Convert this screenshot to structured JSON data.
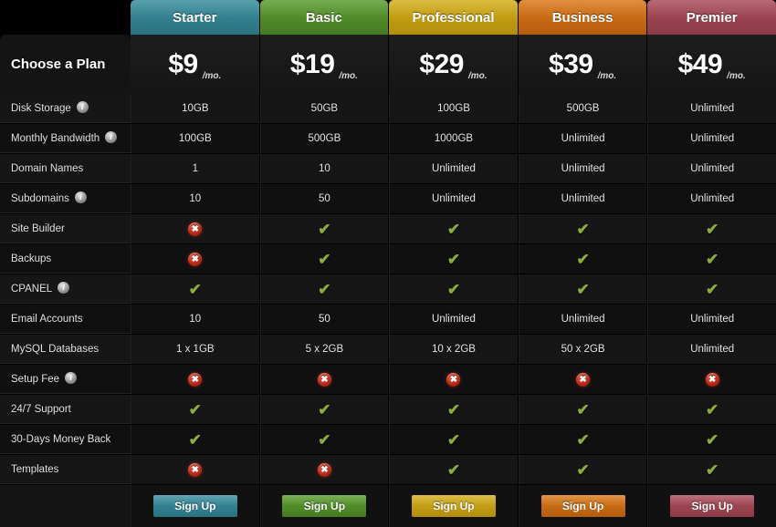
{
  "left_panel": {
    "title": "Choose a Plan"
  },
  "plans": [
    {
      "name": "Starter",
      "price": "$9",
      "per": "/mo.",
      "color": "#3a8f9e",
      "color_dark": "#2b7280",
      "signup_label": "Sign Up"
    },
    {
      "name": "Basic",
      "price": "$19",
      "per": "/mo.",
      "color": "#5c9d2f",
      "color_dark": "#467a22",
      "signup_label": "Sign Up"
    },
    {
      "name": "Professional",
      "price": "$29",
      "per": "/mo.",
      "color": "#d4ae1c",
      "color_dark": "#b08d0c",
      "signup_label": "Sign Up"
    },
    {
      "name": "Business",
      "price": "$39",
      "per": "/mo.",
      "color": "#da7a1c",
      "color_dark": "#b35c0d",
      "signup_label": "Sign Up"
    },
    {
      "name": "Premier",
      "price": "$49",
      "per": "/mo.",
      "color": "#ab4d5b",
      "color_dark": "#8c3a47",
      "signup_label": "Sign Up"
    }
  ],
  "features": [
    {
      "label": "Disk Storage",
      "info": true,
      "values": [
        "10GB",
        "50GB",
        "100GB",
        "500GB",
        "Unlimited"
      ]
    },
    {
      "label": "Monthly Bandwidth",
      "info": true,
      "values": [
        "100GB",
        "500GB",
        "1000GB",
        "Unlimited",
        "Unlimited"
      ]
    },
    {
      "label": "Domain Names",
      "info": false,
      "values": [
        "1",
        "10",
        "Unlimited",
        "Unlimited",
        "Unlimited"
      ]
    },
    {
      "label": "Subdomains",
      "info": true,
      "values": [
        "10",
        "50",
        "Unlimited",
        "Unlimited",
        "Unlimited"
      ]
    },
    {
      "label": "Site Builder",
      "info": false,
      "values": [
        "no",
        "yes",
        "yes",
        "yes",
        "yes"
      ]
    },
    {
      "label": "Backups",
      "info": false,
      "values": [
        "no",
        "yes",
        "yes",
        "yes",
        "yes"
      ]
    },
    {
      "label": "CPANEL",
      "info": true,
      "values": [
        "yes",
        "yes",
        "yes",
        "yes",
        "yes"
      ]
    },
    {
      "label": "Email Accounts",
      "info": false,
      "values": [
        "10",
        "50",
        "Unlimited",
        "Unlimited",
        "Unlimited"
      ]
    },
    {
      "label": "MySQL Databases",
      "info": false,
      "values": [
        "1 x 1GB",
        "5 x 2GB",
        "10 x 2GB",
        "50 x 2GB",
        "Unlimited"
      ]
    },
    {
      "label": "Setup Fee",
      "info": true,
      "values": [
        "no",
        "no",
        "no",
        "no",
        "no"
      ]
    },
    {
      "label": "24/7 Support",
      "info": false,
      "values": [
        "yes",
        "yes",
        "yes",
        "yes",
        "yes"
      ]
    },
    {
      "label": "30-Days Money Back",
      "info": false,
      "values": [
        "yes",
        "yes",
        "yes",
        "yes",
        "yes"
      ]
    },
    {
      "label": "Templates",
      "info": false,
      "values": [
        "no",
        "no",
        "yes",
        "yes",
        "yes"
      ]
    }
  ],
  "icons": {
    "info": "i",
    "check": "✔",
    "cross": "✖"
  }
}
